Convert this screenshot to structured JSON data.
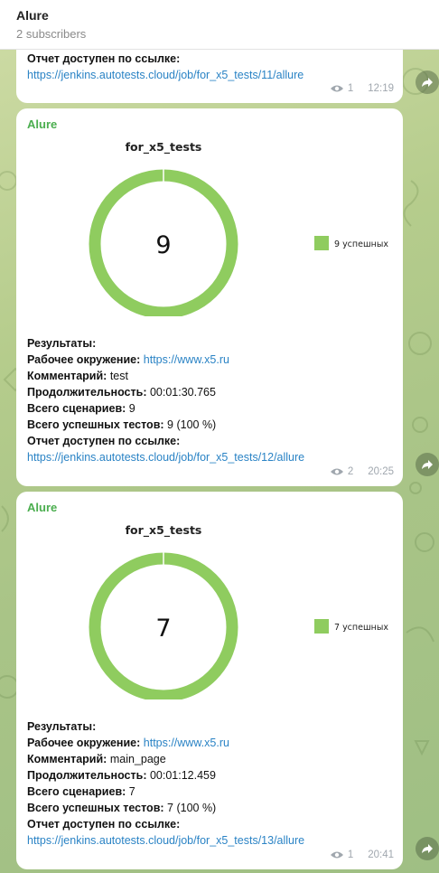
{
  "channel": {
    "title": "Alure",
    "subscribers": "2 subscribers"
  },
  "messages": [
    {
      "author": "",
      "report_label": "Отчет доступен по ссылке:",
      "report_link": "https://jenkins.autotests.cloud/job/for_x5_tests/11/allure",
      "views": "1",
      "time": "12:19"
    },
    {
      "author": "Alure",
      "results_label": "Результаты:",
      "env_label": "Рабочее окружение:",
      "env_value": "https://www.x5.ru",
      "comment_label": "Комментарий:",
      "comment_value": "test",
      "duration_label": "Продолжительность:",
      "duration_value": "00:01:30.765",
      "scenarios_label": "Всего сценариев:",
      "scenarios_value": "9",
      "passed_label": "Всего успешных тестов:",
      "passed_value": "9 (100 %)",
      "report_label": "Отчет доступен по ссылке:",
      "report_link": "https://jenkins.autotests.cloud/job/for_x5_tests/12/allure",
      "views": "2",
      "time": "20:25",
      "chart": {
        "title": "for_x5_tests",
        "center": "9",
        "legend": "9 успешных"
      }
    },
    {
      "author": "Alure",
      "results_label": "Результаты:",
      "env_label": "Рабочее окружение:",
      "env_value": "https://www.x5.ru",
      "comment_label": "Комментарий:",
      "comment_value": "main_page",
      "duration_label": "Продолжительность:",
      "duration_value": "00:01:12.459",
      "scenarios_label": "Всего сценариев:",
      "scenarios_value": "7",
      "passed_label": "Всего успешных тестов:",
      "passed_value": "7 (100 %)",
      "report_label": "Отчет доступен по ссылке:",
      "report_link": "https://jenkins.autotests.cloud/job/for_x5_tests/13/allure",
      "views": "1",
      "time": "20:41",
      "chart": {
        "title": "for_x5_tests",
        "center": "7",
        "legend": "7 успешных"
      }
    }
  ],
  "chart_data": [
    {
      "type": "pie",
      "title": "for_x5_tests",
      "categories": [
        "9 успешных"
      ],
      "values": [
        9
      ],
      "colors": [
        "#8fcc5f"
      ],
      "center_label": "9",
      "legend": "right"
    },
    {
      "type": "pie",
      "title": "for_x5_tests",
      "categories": [
        "7 успешных"
      ],
      "values": [
        7
      ],
      "colors": [
        "#8fcc5f"
      ],
      "center_label": "7",
      "legend": "right"
    }
  ],
  "colors": {
    "success": "#8fcc5f",
    "link": "#2a83c5",
    "author": "#4bae4f"
  }
}
